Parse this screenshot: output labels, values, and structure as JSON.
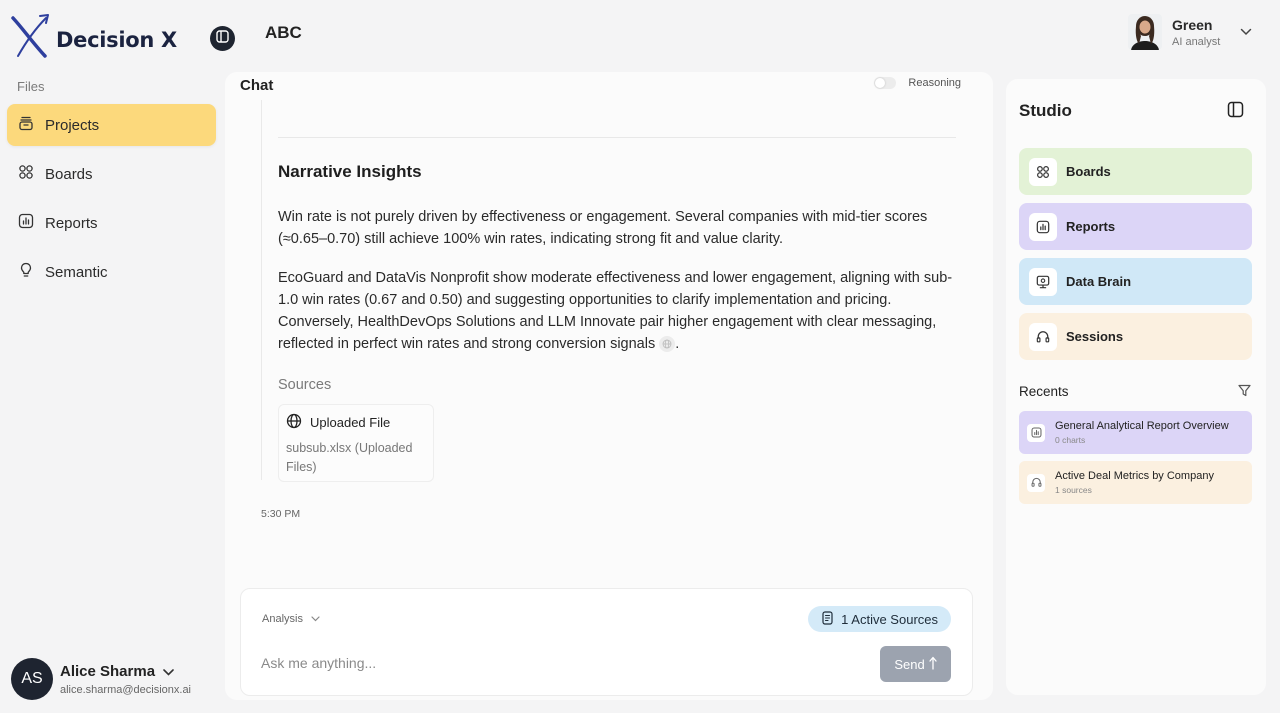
{
  "app": {
    "name": "Decision X",
    "project_name": "ABC"
  },
  "current_user": {
    "name": "Green",
    "role": "AI analyst"
  },
  "sidebar": {
    "section_label": "Files",
    "items": [
      {
        "label": "Projects",
        "icon": "folder-stack-icon",
        "active": true
      },
      {
        "label": "Boards",
        "icon": "grid-icon",
        "active": false
      },
      {
        "label": "Reports",
        "icon": "bar-chart-icon",
        "active": false
      },
      {
        "label": "Semantic",
        "icon": "lightbulb-icon",
        "active": false
      }
    ],
    "accent_color": "#fcd97c"
  },
  "account": {
    "initials": "AS",
    "name": "Alice Sharma",
    "email": "alice.sharma@decisionx.ai"
  },
  "chat": {
    "title": "Chat",
    "reasoning_label": "Reasoning",
    "reasoning_on": false,
    "message": {
      "heading": "Narrative Insights",
      "paragraph1": "Win rate is not purely driven by effectiveness or engagement. Several companies with mid-tier scores (≈0.65–0.70) still achieve 100% win rates, indicating strong fit and value clarity.",
      "paragraph2": "EcoGuard and DataVis Nonprofit show moderate effectiveness and lower engagement, aligning with sub-1.0 win rates (0.67 and 0.50) and suggesting opportunities to clarify implementation and pricing. Conversely, HealthDevOps Solutions and LLM Innovate pair higher engagement with clear messaging, reflected in perfect win rates and strong conversion signals",
      "paragraph2_end": ".",
      "sources_label": "Sources",
      "source": {
        "title": "Uploaded File",
        "description": "subsub.xlsx (Uploaded Files)"
      },
      "timestamp": "5:30 PM"
    },
    "composer": {
      "mode": "Analysis",
      "active_sources": "1 Active Sources",
      "placeholder": "Ask me anything...",
      "send_label": "Send"
    }
  },
  "studio": {
    "title": "Studio",
    "tiles": [
      {
        "label": "Boards",
        "icon": "grid-icon",
        "color": "#e3f2d6"
      },
      {
        "label": "Reports",
        "icon": "bar-chart-icon",
        "color": "#dcd5f7"
      },
      {
        "label": "Data Brain",
        "icon": "monitor-brain-icon",
        "color": "#d0e8f7"
      },
      {
        "label": "Sessions",
        "icon": "headset-icon",
        "color": "#fbf0e0"
      }
    ],
    "recents_title": "Recents",
    "recents": [
      {
        "title": "General Analytical Report Overview",
        "subtitle": "0 charts",
        "icon": "bar-chart-icon"
      },
      {
        "title": "Active Deal Metrics by Company",
        "subtitle": "1 sources",
        "icon": "headset-icon"
      }
    ]
  }
}
